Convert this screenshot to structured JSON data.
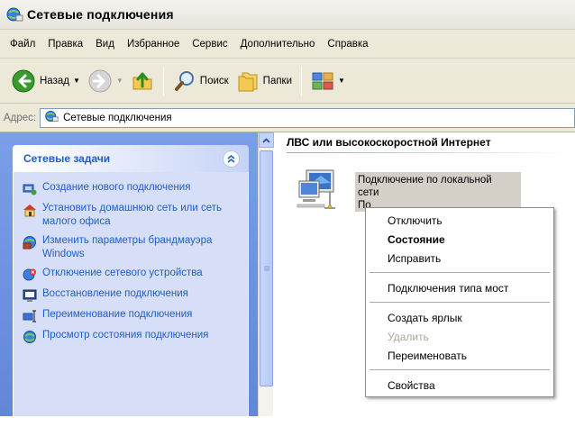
{
  "window": {
    "title": "Сетевые подключения",
    "icon": "network-connections-icon"
  },
  "menubar": {
    "items": [
      "Файл",
      "Правка",
      "Вид",
      "Избранное",
      "Сервис",
      "Дополнительно",
      "Справка"
    ]
  },
  "toolbar": {
    "back_label": "Назад",
    "search_label": "Поиск",
    "folders_label": "Папки",
    "icons": [
      "back-arrow-icon",
      "forward-arrow-icon",
      "up-folder-icon",
      "search-icon",
      "folders-icon",
      "views-icon"
    ]
  },
  "address": {
    "label": "Адрес:",
    "value": "Сетевые подключения"
  },
  "tasks": {
    "title": "Сетевые задачи",
    "items": [
      {
        "icon": "new-connection-icon",
        "label": "Создание нового подключения"
      },
      {
        "icon": "home-network-icon",
        "label": "Установить домашнюю сеть или сеть малого офиса"
      },
      {
        "icon": "firewall-icon",
        "label": "Изменить параметры брандмауэра Windows"
      },
      {
        "icon": "disable-device-icon",
        "label": "Отключение сетевого устройства"
      },
      {
        "icon": "repair-icon",
        "label": "Восстановление подключения"
      },
      {
        "icon": "rename-icon",
        "label": "Переименование подключения"
      },
      {
        "icon": "status-icon",
        "label": "Просмотр состояния подключения"
      }
    ]
  },
  "content": {
    "group_title": "ЛВС или высокоскоростной Интернет",
    "connection": {
      "name_line1": "Подключение по локальной",
      "name_line2": "сети",
      "name_line3": "По"
    }
  },
  "context_menu": {
    "items": [
      {
        "label": "Отключить",
        "style": "normal"
      },
      {
        "label": "Состояние",
        "style": "bold"
      },
      {
        "label": "Исправить",
        "style": "normal"
      },
      {
        "separator": true
      },
      {
        "label": "Подключения типа мост",
        "style": "normal"
      },
      {
        "separator": true
      },
      {
        "label": "Создать ярлык",
        "style": "normal"
      },
      {
        "label": "Удалить",
        "style": "disabled"
      },
      {
        "label": "Переименовать",
        "style": "normal"
      },
      {
        "separator": true
      },
      {
        "label": "Свойства",
        "style": "normal"
      }
    ]
  },
  "colors": {
    "task_link": "#215dc6",
    "task_pane": "#7a9fe8",
    "selection": "#d4d0c8",
    "disabled_text": "#aca899"
  }
}
